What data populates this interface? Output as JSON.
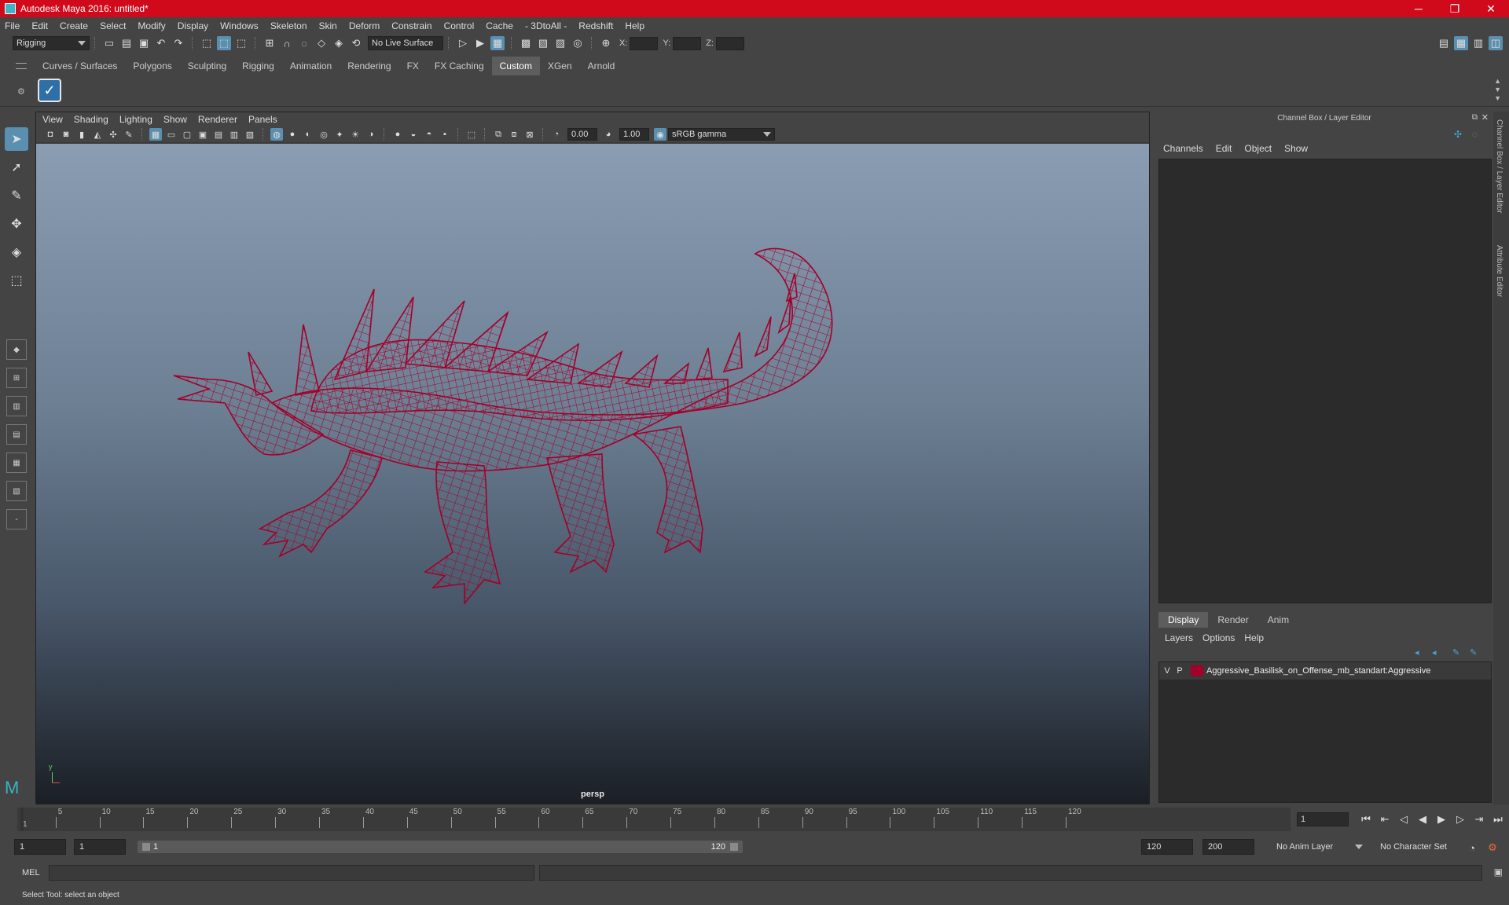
{
  "window": {
    "title": "Autodesk Maya 2016: untitled*",
    "controls": [
      "─",
      "❐",
      "✕"
    ]
  },
  "menubar": [
    "File",
    "Edit",
    "Create",
    "Select",
    "Modify",
    "Display",
    "Windows",
    "Skeleton",
    "Skin",
    "Deform",
    "Constrain",
    "Control",
    "Cache",
    "- 3DtoAll -",
    "Redshift",
    "Help"
  ],
  "statusline": {
    "menuset": "Rigging",
    "live_surface": "No Live Surface",
    "x_label": "X:",
    "y_label": "Y:",
    "z_label": "Z:"
  },
  "shelf": {
    "tabs": [
      "Curves / Surfaces",
      "Polygons",
      "Sculpting",
      "Rigging",
      "Animation",
      "Rendering",
      "FX",
      "FX Caching",
      "Custom",
      "XGen",
      "Arnold"
    ],
    "selected_tab": "Custom"
  },
  "viewport": {
    "menu": [
      "View",
      "Shading",
      "Lighting",
      "Show",
      "Renderer",
      "Panels"
    ],
    "exposure": "0.00",
    "gamma": "1.00",
    "color_space": "sRGB gamma",
    "camera": "persp",
    "wire_color": "#a3002a"
  },
  "channelbox": {
    "title": "Channel Box / Layer Editor",
    "menu": [
      "Channels",
      "Edit",
      "Object",
      "Show"
    ],
    "layer_tabs": [
      "Display",
      "Render",
      "Anim"
    ],
    "layer_menu": [
      "Layers",
      "Options",
      "Help"
    ],
    "layer": {
      "v": "V",
      "p": "P",
      "color": "#a3002a",
      "name": "Aggressive_Basilisk_on_Offense_mb_standart:Aggressive"
    },
    "side_tabs": [
      "Channel Box / Layer Editor",
      "Attribute Editor"
    ]
  },
  "timeline": {
    "ticks": [
      "1",
      "5",
      "10",
      "15",
      "20",
      "25",
      "30",
      "35",
      "40",
      "45",
      "50",
      "55",
      "60",
      "65",
      "70",
      "75",
      "80",
      "85",
      "90",
      "95",
      "100",
      "105",
      "110",
      "115",
      "120"
    ],
    "current_frame": "1",
    "start": "1",
    "range_start": "1",
    "range_bar_start": "1",
    "range_bar_end": "120",
    "range_end": "120",
    "end": "200",
    "anim_layer": "No Anim Layer",
    "character_set": "No Character Set"
  },
  "command": {
    "language": "MEL",
    "help": "Select Tool: select an object"
  }
}
